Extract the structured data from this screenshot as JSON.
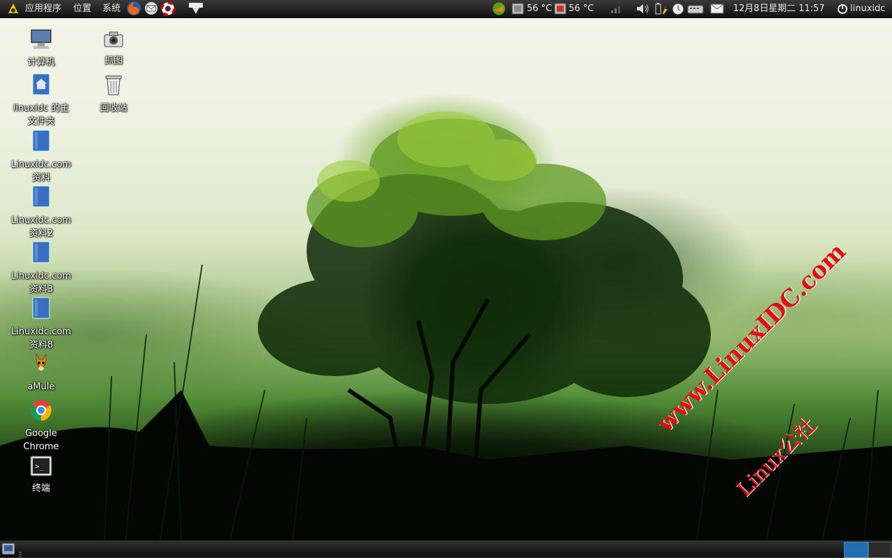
{
  "top_panel": {
    "menu_apps": "应用程序",
    "menu_places": "位置",
    "menu_system": "系统",
    "temp1": "56 °C",
    "temp2": "56 °C",
    "datetime": "12月8日星期二 11:57",
    "username": "linuxidc"
  },
  "desktop": {
    "icons": [
      {
        "label": "计算机",
        "icon": "computer-icon"
      },
      {
        "label": "抓图",
        "icon": "camera-icon"
      },
      {
        "label_line1": "linuxidc 的主",
        "label_line2": "文件夹",
        "icon": "home-folder-icon"
      },
      {
        "label": "回收站",
        "icon": "trash-icon"
      },
      {
        "label_line1": "Linuxidc.com",
        "label_line2": "资料",
        "icon": "folder-icon"
      },
      {
        "label_line1": "Linuxidc.com",
        "label_line2": "资料2",
        "icon": "folder-icon"
      },
      {
        "label_line1": "Linuxidc.com",
        "label_line2": "资料3",
        "icon": "folder-icon"
      },
      {
        "label_line1": "Linuxidc.com",
        "label_line2": "资料8",
        "icon": "folder-icon"
      },
      {
        "label": "aMule",
        "icon": "amule-icon"
      },
      {
        "label_line1": "Google",
        "label_line2": "Chrome",
        "icon": "chrome-icon"
      },
      {
        "label": "终端",
        "icon": "terminal-icon"
      }
    ]
  },
  "watermark": {
    "line1": "www.LinuxIDC.com",
    "line2": "Linux公社"
  },
  "colors": {
    "panel": "#1a1a1a",
    "watermark": "#e01010",
    "workspace_active": "#1f6fb0"
  }
}
